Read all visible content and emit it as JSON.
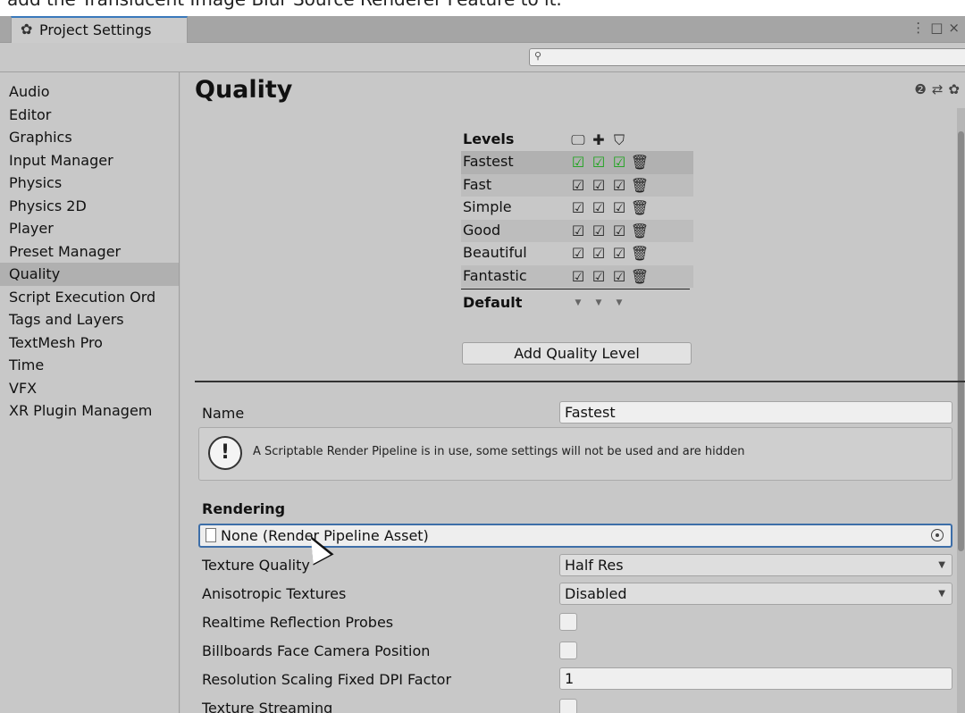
{
  "top_note": "add the Translucent Image Blur Source Renderer Feature to it.",
  "tab": {
    "icon": "gear-icon",
    "label": "Project Settings"
  },
  "window_controls": {
    "menu": "⋮",
    "maximize": "□",
    "close": "×"
  },
  "search": {
    "placeholder": "",
    "icon": "search-icon"
  },
  "sidebar": {
    "selected": "Quality",
    "items": [
      {
        "label": "Audio"
      },
      {
        "label": "Editor"
      },
      {
        "label": "Graphics"
      },
      {
        "label": "Input Manager"
      },
      {
        "label": "Physics"
      },
      {
        "label": "Physics 2D"
      },
      {
        "label": "Player"
      },
      {
        "label": "Preset Manager"
      },
      {
        "label": "Quality"
      },
      {
        "label": "Script Execution Ord"
      },
      {
        "label": "Tags and Layers"
      },
      {
        "label": "TextMesh Pro"
      },
      {
        "label": "Time"
      },
      {
        "label": "VFX"
      },
      {
        "label": "XR Plugin Managem"
      }
    ]
  },
  "main": {
    "title": "Quality",
    "title_icons": [
      "help-icon",
      "preset-icon",
      "gear-icon"
    ],
    "levels": {
      "header": "Levels",
      "platform_icons": [
        "monitor-icon",
        "android-icon",
        "html5-icon"
      ],
      "rows": [
        {
          "name": "Fastest",
          "selected": true
        },
        {
          "name": "Fast"
        },
        {
          "name": "Simple"
        },
        {
          "name": "Good"
        },
        {
          "name": "Beautiful"
        },
        {
          "name": "Fantastic"
        }
      ],
      "default_label": "Default"
    },
    "add_button": "Add Quality Level",
    "name_label": "Name",
    "name_value": "Fastest",
    "help_message": "A Scriptable Render Pipeline is in use, some settings will not be used and are hidden",
    "rendering_header": "Rendering",
    "pipeline_asset": "None (Render Pipeline Asset)",
    "texture_quality": {
      "label": "Texture Quality",
      "value": "Half Res"
    },
    "anisotropic": {
      "label": "Anisotropic Textures",
      "value": "Disabled"
    },
    "realtime_reflection": {
      "label": "Realtime Reflection Probes"
    },
    "billboards": {
      "label": "Billboards Face Camera Position"
    },
    "resolution_scaling": {
      "label": "Resolution Scaling Fixed DPI Factor",
      "value": "1"
    },
    "texture_streaming": {
      "label": "Texture Streaming"
    }
  }
}
